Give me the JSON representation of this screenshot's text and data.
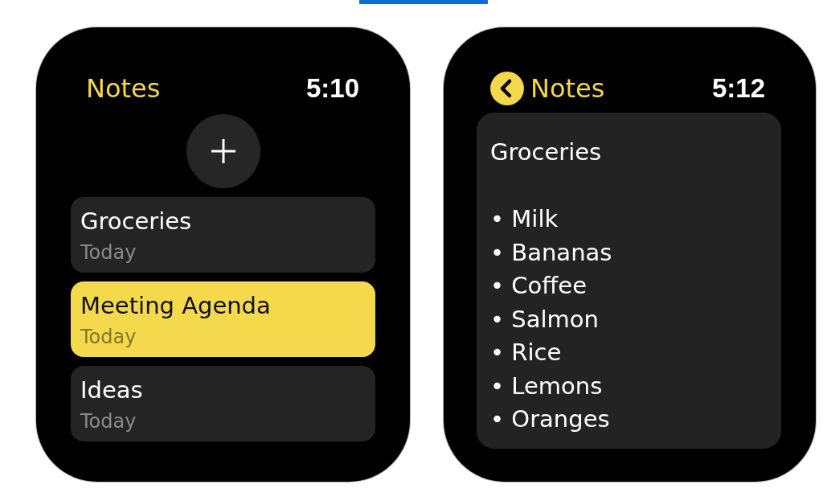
{
  "list_screen": {
    "title": "Notes",
    "time": "5:10",
    "notes": [
      {
        "title": "Groceries",
        "date": "Today",
        "selected": false
      },
      {
        "title": "Meeting Agenda",
        "date": "Today",
        "selected": true
      },
      {
        "title": "Ideas",
        "date": "Today",
        "selected": false
      }
    ]
  },
  "note_screen": {
    "back_label": "Notes",
    "time": "5:12",
    "note": {
      "title": "Groceries",
      "lines": [
        "• Milk",
        "• Bananas",
        "• Coffee",
        "• Salmon",
        "• Rice",
        "• Lemons",
        "• Oranges"
      ]
    }
  }
}
